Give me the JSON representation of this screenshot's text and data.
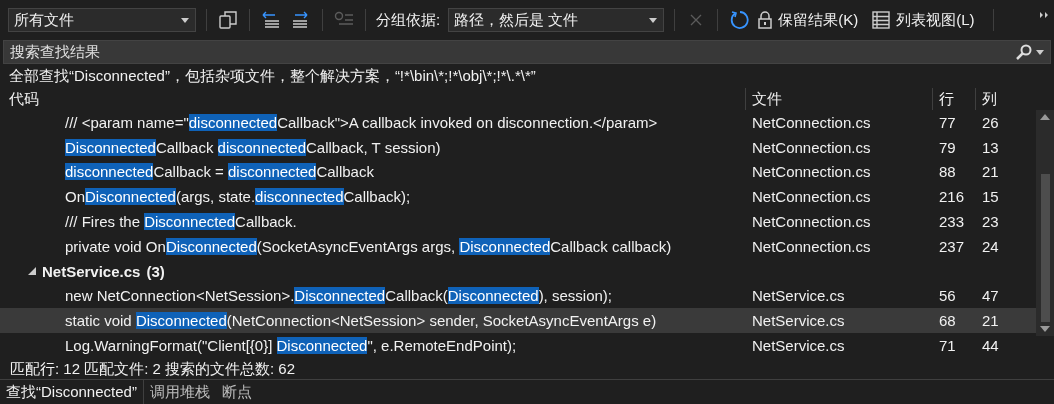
{
  "toolbar": {
    "scope": "所有文件",
    "group_by_label": "分组依据:",
    "group_by": "路径，然后是 文件",
    "keep_results": "保留结果(K)",
    "list_view": "列表视图(L)",
    "filter_disabled": true,
    "clear_disabled": true
  },
  "search": {
    "placeholder": "搜索查找结果"
  },
  "summary": "全部查找“Disconnected”，包括杂项文件，整个解决方案，“!*\\bin\\*;!*\\obj\\*;!*\\.*\\*”",
  "columns": [
    "代码",
    "文件",
    "行",
    "列"
  ],
  "groups": [
    {
      "rows": [
        {
          "code": [
            {
              "t": "/// <param name=\""
            },
            {
              "t": "disconnected",
              "match": true
            },
            {
              "t": "Callback\">A callback invoked on disconnection.</param>"
            }
          ],
          "file": "NetConnection.cs",
          "line": "77",
          "col": "26",
          "selected": false
        },
        {
          "code": [
            {
              "t": "Disconnected",
              "match": true
            },
            {
              "t": "Callback "
            },
            {
              "t": "disconnected",
              "match": true
            },
            {
              "t": "Callback, T session)"
            }
          ],
          "file": "NetConnection.cs",
          "line": "79",
          "col": "13",
          "selected": false
        },
        {
          "code": [
            {
              "t": "disconnected",
              "match": true
            },
            {
              "t": "Callback = "
            },
            {
              "t": "disconnected",
              "match": true
            },
            {
              "t": "Callback"
            }
          ],
          "file": "NetConnection.cs",
          "line": "88",
          "col": "21",
          "selected": false
        },
        {
          "code": [
            {
              "t": "On"
            },
            {
              "t": "Disconnected",
              "match": true
            },
            {
              "t": "(args, state."
            },
            {
              "t": "disconnected",
              "match": true
            },
            {
              "t": "Callback);"
            }
          ],
          "file": "NetConnection.cs",
          "line": "216",
          "col": "15",
          "selected": false
        },
        {
          "code": [
            {
              "t": "/// Fires the "
            },
            {
              "t": "Disconnected",
              "match": true
            },
            {
              "t": "Callback."
            }
          ],
          "file": "NetConnection.cs",
          "line": "233",
          "col": "23",
          "selected": false
        },
        {
          "code": [
            {
              "t": "private void On"
            },
            {
              "t": "Disconnected",
              "match": true
            },
            {
              "t": "(SocketAsyncEventArgs args, "
            },
            {
              "t": "Disconnected",
              "match": true
            },
            {
              "t": "Callback callback)"
            }
          ],
          "file": "NetConnection.cs",
          "line": "237",
          "col": "24",
          "selected": false
        }
      ]
    },
    {
      "name": "NetService.cs",
      "count": "(3)",
      "expanded": true,
      "rows": [
        {
          "code": [
            {
              "t": "new NetConnection<NetSession>."
            },
            {
              "t": "Disconnected",
              "match": true
            },
            {
              "t": "Callback("
            },
            {
              "t": "Disconnected",
              "match": true
            },
            {
              "t": "), session);"
            }
          ],
          "file": "NetService.cs",
          "line": "56",
          "col": "47",
          "selected": false
        },
        {
          "code": [
            {
              "t": "static void "
            },
            {
              "t": "Disconnected",
              "match": true
            },
            {
              "t": "(NetConnection<NetSession> sender, SocketAsyncEventArgs e)"
            }
          ],
          "file": "NetService.cs",
          "line": "68",
          "col": "21",
          "selected": true
        },
        {
          "code": [
            {
              "t": "Log.WarningFormat(\"Client[{0}] "
            },
            {
              "t": "Disconnected",
              "match": true
            },
            {
              "t": "\", e.RemoteEndPoint);"
            }
          ],
          "file": "NetService.cs",
          "line": "71",
          "col": "44",
          "selected": false
        }
      ]
    }
  ],
  "status": "匹配行: 12 匹配文件: 2 搜索的文件总数: 62",
  "tabs": [
    {
      "label": "查找“Disconnected”",
      "selected": true
    },
    {
      "label": "调用堆栈",
      "selected": false
    },
    {
      "label": "断点",
      "selected": false
    }
  ]
}
